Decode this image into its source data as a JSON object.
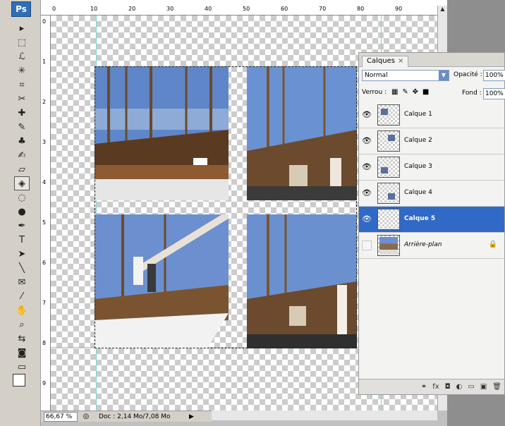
{
  "toolbar": {
    "logo": "Ps",
    "tools": [
      {
        "icon": "move-icon",
        "glyph": "▸"
      },
      {
        "icon": "marquee-icon",
        "glyph": "⬚"
      },
      {
        "icon": "lasso-icon",
        "glyph": "ℒ"
      },
      {
        "icon": "magic-wand-icon",
        "glyph": "✳"
      },
      {
        "icon": "crop-icon",
        "glyph": "⌗"
      },
      {
        "icon": "slice-icon",
        "glyph": "✂"
      },
      {
        "icon": "healing-icon",
        "glyph": "✚"
      },
      {
        "icon": "brush-icon",
        "glyph": "✎"
      },
      {
        "icon": "stamp-icon",
        "glyph": "♣"
      },
      {
        "icon": "history-brush-icon",
        "glyph": "✍"
      },
      {
        "icon": "eraser-icon",
        "glyph": "▱"
      },
      {
        "icon": "paint-bucket-icon",
        "glyph": "◈"
      },
      {
        "icon": "blur-icon",
        "glyph": "◌"
      },
      {
        "icon": "dodge-icon",
        "glyph": "●"
      },
      {
        "icon": "pen-icon",
        "glyph": "✒"
      },
      {
        "icon": "type-icon",
        "glyph": "T"
      },
      {
        "icon": "path-select-icon",
        "glyph": "➤"
      },
      {
        "icon": "line-icon",
        "glyph": "╲"
      },
      {
        "icon": "notes-icon",
        "glyph": "✉"
      },
      {
        "icon": "eyedropper-icon",
        "glyph": "⁄"
      },
      {
        "icon": "hand-icon",
        "glyph": "✋"
      },
      {
        "icon": "zoom-icon",
        "glyph": "⌕"
      },
      {
        "icon": "swap-colors-icon",
        "glyph": "⇆"
      },
      {
        "icon": "quick-mask-icon",
        "glyph": "◙"
      },
      {
        "icon": "screen-mode-icon",
        "glyph": "▭"
      }
    ]
  },
  "ruler_top": [
    "0",
    "10",
    "20",
    "30",
    "40",
    "50",
    "60",
    "70",
    "80",
    "90"
  ],
  "ruler_left": [
    "0",
    "1",
    "2",
    "3",
    "4",
    "5",
    "6",
    "7",
    "8",
    "9"
  ],
  "status": {
    "zoom": "66,67 %",
    "doc": "Doc : 2,14 Mo/7,08 Mo",
    "arrow": "▶"
  },
  "layers_panel": {
    "tab": "Calques",
    "tab_close": "×",
    "blend_mode": "Normal",
    "opacity_label": "Opacité :",
    "opacity_value": "100%",
    "lock_label": "Verrou :",
    "fill_label": "Fond :",
    "fill_value": "100%",
    "layers": [
      {
        "name": "Calque 1",
        "visible": true,
        "active": false
      },
      {
        "name": "Calque 2",
        "visible": true,
        "active": false
      },
      {
        "name": "Calque 3",
        "visible": true,
        "active": false
      },
      {
        "name": "Calque 4",
        "visible": true,
        "active": false
      },
      {
        "name": "Calque 5",
        "visible": true,
        "active": true
      },
      {
        "name": "Arrière-plan",
        "visible": false,
        "active": false,
        "locked": true
      }
    ],
    "footer_icons": [
      "link-icon",
      "fx-icon",
      "mask-icon",
      "adjustment-icon",
      "group-icon",
      "new-layer-icon",
      "trash-icon"
    ]
  },
  "colors": {
    "selected_layer": "#3169c6",
    "guide": "#7fd3d3",
    "canvas_check": "#cccccc"
  }
}
